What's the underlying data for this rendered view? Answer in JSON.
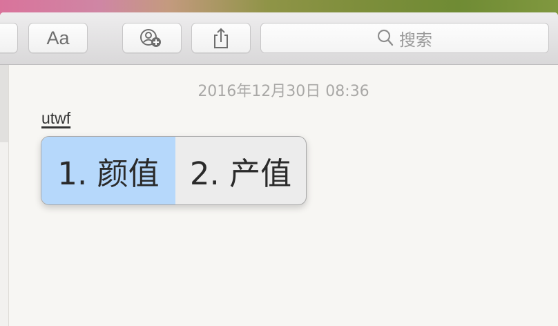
{
  "toolbar": {
    "font_button_label": "Aa",
    "search_placeholder": "搜索"
  },
  "note": {
    "timestamp": "2016年12月30日 08:36",
    "composing_text": "utwf"
  },
  "ime": {
    "candidates": [
      {
        "label": "1. 颜值",
        "selected": true
      },
      {
        "label": "2. 产值",
        "selected": false
      }
    ]
  },
  "colors": {
    "selected_candidate": "#b6d8fb",
    "candidate_bg": "#ececec",
    "toolbar_bg": "#e4e3e4"
  },
  "icons": {
    "add_people": "person-add-icon",
    "share": "share-icon",
    "search": "search-icon"
  }
}
